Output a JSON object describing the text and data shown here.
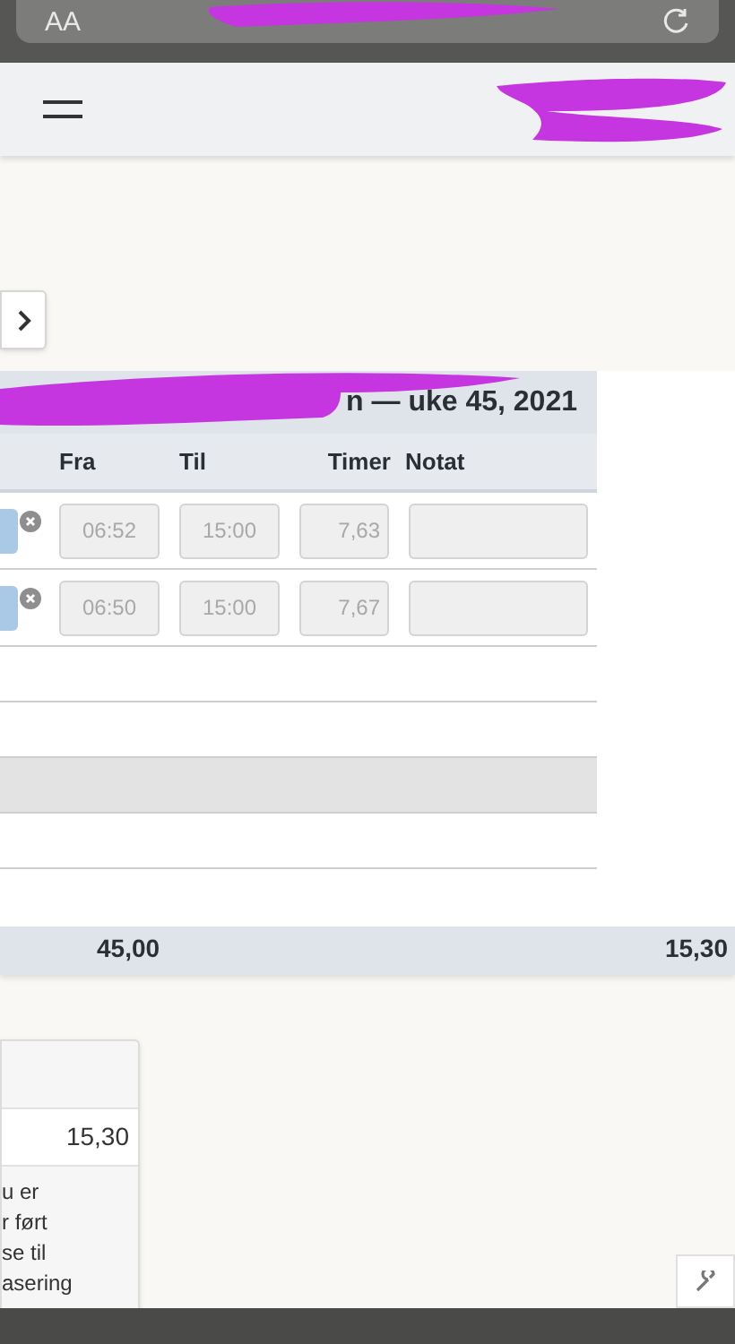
{
  "browser_bar": {
    "text_size_button": "AA"
  },
  "week_table": {
    "title": "n — uke 45, 2021",
    "columns": [
      "Fra",
      "Til",
      "Timer",
      "Notat"
    ],
    "rows": [
      {
        "kind": "entry",
        "fra": "06:52",
        "til": "15:00",
        "timer": "7,63"
      },
      {
        "kind": "entry",
        "fra": "06:50",
        "til": "15:00",
        "timer": "7,67"
      },
      {
        "kind": "empty",
        "shaded": false
      },
      {
        "kind": "empty",
        "shaded": false
      },
      {
        "kind": "empty",
        "shaded": true
      },
      {
        "kind": "empty",
        "shaded": false
      }
    ],
    "totals": [
      "45,00",
      "15,30"
    ]
  },
  "summary_card": {
    "value": "15,30",
    "note_lines": [
      "u er",
      "r ført",
      "se til",
      "asering"
    ]
  }
}
